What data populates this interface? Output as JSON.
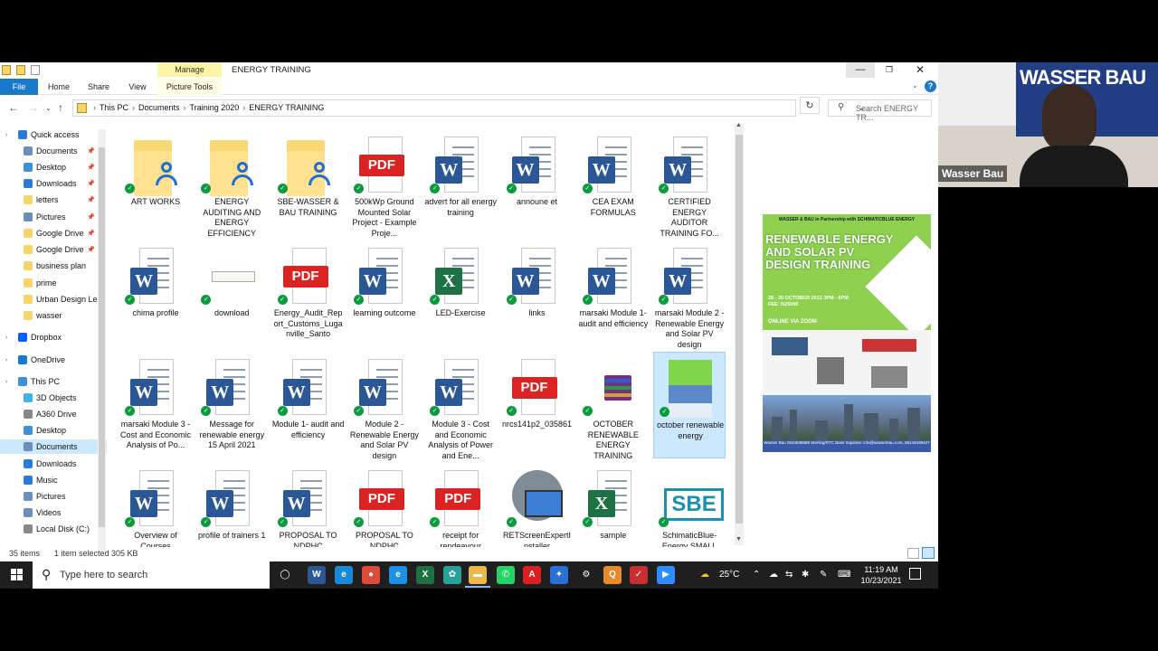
{
  "window": {
    "title": "ENERGY TRAINING",
    "contextual_tab_group": "Manage",
    "controls": {
      "minimize": "—",
      "maximize": "❐",
      "close": "✕"
    }
  },
  "ribbon": {
    "tabs": [
      "File",
      "Home",
      "Share",
      "View",
      "Picture Tools"
    ]
  },
  "address": {
    "crumbs": [
      "This PC",
      "Documents",
      "Training 2020",
      "ENERGY TRAINING"
    ],
    "search_placeholder": "Search ENERGY TR..."
  },
  "sidebar": {
    "items": [
      {
        "label": "Quick access",
        "icon": "star-icon",
        "color": "#2b7bd6",
        "pinned": false,
        "level": 0
      },
      {
        "label": "Documents",
        "icon": "documents-icon",
        "color": "#6b8fb8",
        "pinned": true,
        "level": 1
      },
      {
        "label": "Desktop",
        "icon": "desktop-icon",
        "color": "#3d8fd6",
        "pinned": true,
        "level": 1
      },
      {
        "label": "Downloads",
        "icon": "downloads-icon",
        "color": "#2b7bd6",
        "pinned": true,
        "level": 1
      },
      {
        "label": "letters",
        "icon": "folder-icon",
        "color": "#f6d36b",
        "pinned": true,
        "level": 1
      },
      {
        "label": "Pictures",
        "icon": "pictures-icon",
        "color": "#6b8fb8",
        "pinned": true,
        "level": 1
      },
      {
        "label": "Google Drive",
        "icon": "folder-icon",
        "color": "#f6d36b",
        "pinned": true,
        "level": 1
      },
      {
        "label": "Google Drive",
        "icon": "folder-icon",
        "color": "#f6d36b",
        "pinned": true,
        "level": 1
      },
      {
        "label": "business plan",
        "icon": "folder-icon",
        "color": "#f6d36b",
        "pinned": false,
        "level": 1
      },
      {
        "label": "prime",
        "icon": "folder-icon",
        "color": "#f6d36b",
        "pinned": false,
        "level": 1
      },
      {
        "label": "Urban Design Le",
        "icon": "folder-icon",
        "color": "#f6d36b",
        "pinned": false,
        "level": 1
      },
      {
        "label": "wasser",
        "icon": "folder-icon",
        "color": "#f6d36b",
        "pinned": false,
        "level": 1
      },
      {
        "label": "Dropbox",
        "icon": "dropbox-icon",
        "color": "#0061fe",
        "pinned": false,
        "level": 0
      },
      {
        "label": "OneDrive",
        "icon": "onedrive-icon",
        "color": "#1479d2",
        "pinned": false,
        "level": 0
      },
      {
        "label": "This PC",
        "icon": "computer-icon",
        "color": "#3d8fd6",
        "pinned": false,
        "level": 0
      },
      {
        "label": "3D Objects",
        "icon": "3d-objects-icon",
        "color": "#3cb4e6",
        "pinned": false,
        "level": 1
      },
      {
        "label": "A360 Drive",
        "icon": "a360-drive-icon",
        "color": "#888888",
        "pinned": false,
        "level": 1
      },
      {
        "label": "Desktop",
        "icon": "desktop-icon",
        "color": "#3d8fd6",
        "pinned": false,
        "level": 1
      },
      {
        "label": "Documents",
        "icon": "documents-icon",
        "color": "#6b8fb8",
        "pinned": false,
        "level": 1,
        "selected": true
      },
      {
        "label": "Downloads",
        "icon": "downloads-icon",
        "color": "#2b7bd6",
        "pinned": false,
        "level": 1
      },
      {
        "label": "Music",
        "icon": "music-icon",
        "color": "#2b7bd6",
        "pinned": false,
        "level": 1
      },
      {
        "label": "Pictures",
        "icon": "pictures-icon",
        "color": "#6b8fb8",
        "pinned": false,
        "level": 1
      },
      {
        "label": "Videos",
        "icon": "videos-icon",
        "color": "#6b8fb8",
        "pinned": false,
        "level": 1
      },
      {
        "label": "Local Disk (C:)",
        "icon": "disk-icon",
        "color": "#888888",
        "pinned": false,
        "level": 1
      }
    ]
  },
  "files": [
    {
      "name": "ART WORKS",
      "type": "folder"
    },
    {
      "name": "ENERGY AUDITING AND ENERGY EFFICIENCY",
      "type": "folder"
    },
    {
      "name": "SBE-WASSER & BAU TRAINING",
      "type": "folder"
    },
    {
      "name": "500kWp Ground Mounted Solar Project - Example Proje...",
      "type": "pdf"
    },
    {
      "name": "advert for all energy training",
      "type": "word"
    },
    {
      "name": "announe et",
      "type": "word"
    },
    {
      "name": "CEA EXAM FORMULAS",
      "type": "word"
    },
    {
      "name": "CERTIFIED ENERGY AUDITOR TRAINING FO...",
      "type": "word"
    },
    {
      "name": "chima profile",
      "type": "word"
    },
    {
      "name": "download",
      "type": "image"
    },
    {
      "name": "Energy_Audit_Report_Customs_Luganville_Santo",
      "type": "pdf"
    },
    {
      "name": "learning outcome",
      "type": "word"
    },
    {
      "name": "LED-Exercise",
      "type": "excel"
    },
    {
      "name": "links",
      "type": "word"
    },
    {
      "name": "marsaki Module 1- audit and efficiency",
      "type": "word"
    },
    {
      "name": "marsaki Module 2 -Renewable Energy and Solar PV design",
      "type": "word"
    },
    {
      "name": "marsaki Module 3 - Cost and Economic Analysis of Po...",
      "type": "word"
    },
    {
      "name": "Message for renewable energy 15 April 2021",
      "type": "word"
    },
    {
      "name": "Module 1- audit and efficiency",
      "type": "word"
    },
    {
      "name": "Module 2 -Renewable Energy and Solar PV design",
      "type": "word"
    },
    {
      "name": "Module 3 - Cost and Economic Analysis of Power and Ene...",
      "type": "word"
    },
    {
      "name": "nrcs141p2_035861",
      "type": "pdf"
    },
    {
      "name": "OCTOBER RENEWABLE ENERGY TRAINING",
      "type": "winrar"
    },
    {
      "name": "october renewable energy",
      "type": "photo",
      "selected": true
    },
    {
      "name": "Overview of Courses",
      "type": "word"
    },
    {
      "name": "profile of trainers 1",
      "type": "word"
    },
    {
      "name": "PROPOSAL TO NDPHC",
      "type": "word"
    },
    {
      "name": "PROPOSAL TO NDPHC",
      "type": "pdf"
    },
    {
      "name": "receipt for rendeavour",
      "type": "pdf"
    },
    {
      "name": "RETScreenExpertInstaller",
      "type": "installer"
    },
    {
      "name": "sample",
      "type": "excel"
    },
    {
      "name": "SchimaticBlue-Energy SMALL",
      "type": "sbe"
    }
  ],
  "file_type_labels": {
    "word": "W",
    "excel": "X",
    "pdf": "PDF",
    "sbe": "SBE"
  },
  "status": {
    "count": "35 items",
    "selection": "1 item selected  305 KB"
  },
  "preview": {
    "header": "WASSER & BAU in Partnership with SCHIMATICBLUE ENERGY",
    "title": "RENEWABLE ENERGY AND SOLAR PV DESIGN TRAINING",
    "dates": "28 - 30 OCTOBER 2021 3PM - 6PM FEE: N25000",
    "zoom": "ONLINE VIA ZOOM",
    "footer": "Wasser Bau 0044538689 Sterling/RTC Bank Inquiries: info@wasserbau.com, 08148439427"
  },
  "webcam": {
    "name": "Wasser Bau",
    "banner": "WASSER BAU"
  },
  "taskbar": {
    "search_placeholder": "Type here to search",
    "apps": [
      {
        "name": "task-view",
        "glyph": "◯",
        "color": "#1f1f1f"
      },
      {
        "name": "word",
        "glyph": "W",
        "color": "#2b5797"
      },
      {
        "name": "edge",
        "glyph": "e",
        "color": "#1a8ad6"
      },
      {
        "name": "chrome",
        "glyph": "●",
        "color": "#dd4b39"
      },
      {
        "name": "ie",
        "glyph": "e",
        "color": "#1e90e6"
      },
      {
        "name": "excel",
        "glyph": "X",
        "color": "#1e7145"
      },
      {
        "name": "app-green",
        "glyph": "✿",
        "color": "#2aa198"
      },
      {
        "name": "file-explorer",
        "glyph": "▬",
        "color": "#e8b84a"
      },
      {
        "name": "whatsapp",
        "glyph": "✆",
        "color": "#25d366"
      },
      {
        "name": "acrobat",
        "glyph": "A",
        "color": "#d82020"
      },
      {
        "name": "app-blue",
        "glyph": "✦",
        "color": "#2a6fd6"
      },
      {
        "name": "settings",
        "glyph": "⚙",
        "color": "#1f1f1f"
      },
      {
        "name": "app-orange",
        "glyph": "Q",
        "color": "#e8892a"
      },
      {
        "name": "app-red",
        "glyph": "✓",
        "color": "#c83030"
      },
      {
        "name": "zoom",
        "glyph": "▶",
        "color": "#2d8cff"
      }
    ],
    "temperature": "25°C",
    "time": "11:19 AM",
    "date": "10/23/2021"
  }
}
